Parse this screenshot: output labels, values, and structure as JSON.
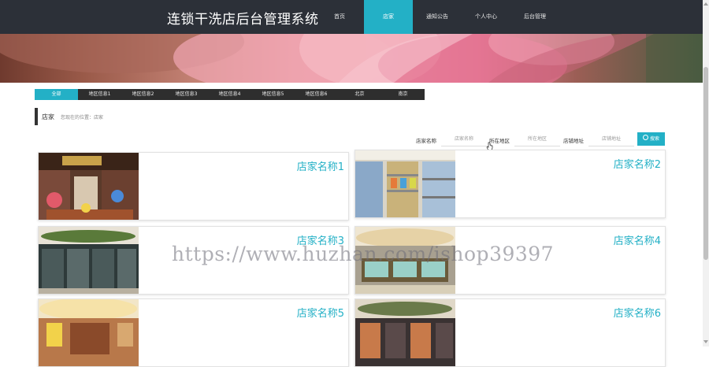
{
  "header": {
    "site_title": "连锁干洗店后台管理系统",
    "nav": [
      {
        "label": "首页",
        "active": false
      },
      {
        "label": "店家",
        "active": true
      },
      {
        "label": "通知公告",
        "active": false
      },
      {
        "label": "个人中心",
        "active": false
      },
      {
        "label": "后台管理",
        "active": false
      }
    ]
  },
  "category_tabs": [
    {
      "label": "全部",
      "active": true
    },
    {
      "label": "地区信息1",
      "active": false
    },
    {
      "label": "地区信息2",
      "active": false
    },
    {
      "label": "地区信息3",
      "active": false
    },
    {
      "label": "地区信息4",
      "active": false
    },
    {
      "label": "地区信息5",
      "active": false
    },
    {
      "label": "地区信息6",
      "active": false
    },
    {
      "label": "北京",
      "active": false
    },
    {
      "label": "南京",
      "active": false
    }
  ],
  "breadcrumb": {
    "title": "店家",
    "text": "您现在的位置：店家"
  },
  "search": {
    "name_label": "店家名称",
    "name_placeholder": "店家名称",
    "region_label": "所在地区",
    "region_placeholder": "所在地区",
    "address_label": "店铺地址",
    "address_placeholder": "店铺地址",
    "button_label": "搜索"
  },
  "cards": [
    {
      "title": "店家名称1",
      "image": "toy-store-photo"
    },
    {
      "title": "店家名称2",
      "image": "supermarket-shelves-photo"
    },
    {
      "title": "店家名称3",
      "image": "shop-interior-photo"
    },
    {
      "title": "店家名称4",
      "image": "shop-counter-photo"
    },
    {
      "title": "店家名称5",
      "image": "shop-interior-photo"
    },
    {
      "title": "店家名称6",
      "image": "shop-interior-photo"
    }
  ],
  "watermark": "https://www.huzhan.com/ishop39397",
  "colors": {
    "accent": "#23b0c6",
    "header_bg": "#2c3038",
    "tab_bg": "#2e2e2e"
  }
}
